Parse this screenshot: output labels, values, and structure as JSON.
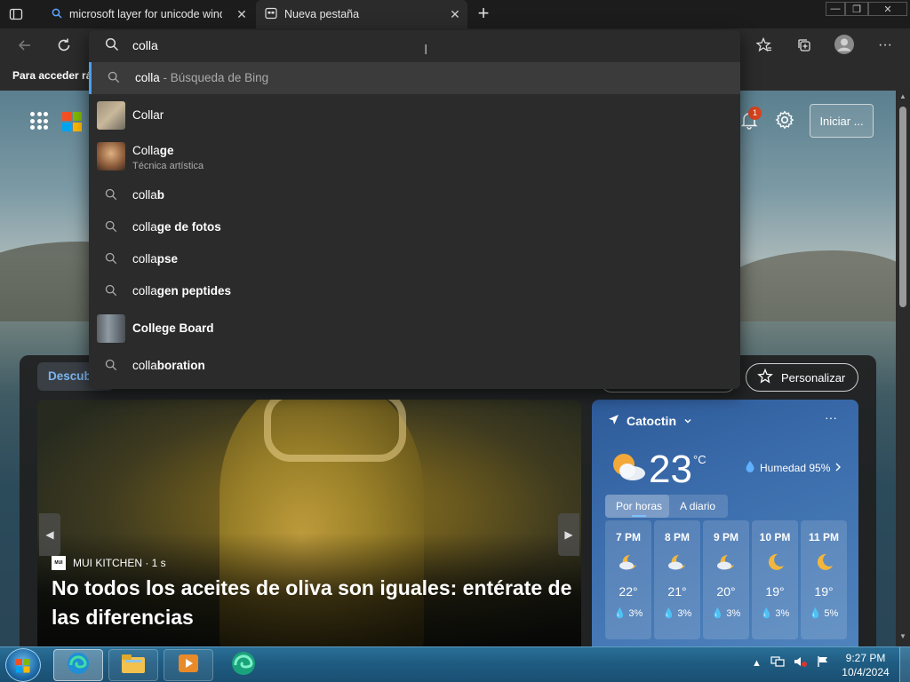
{
  "tabs": [
    {
      "title": "microsoft layer for unicode windows",
      "close": "✕"
    },
    {
      "title": "Nueva pestaña",
      "close": "✕"
    }
  ],
  "new_tab_label": "+",
  "window_controls": {
    "minimize": "—",
    "maximize": "❐",
    "close": "✕"
  },
  "favorites_bar_hint": "Para acceder rápidamente",
  "address_bar": {
    "value": "colla"
  },
  "suggestions": [
    {
      "typed": "colla",
      "completion": "",
      "suffix": " - Búsqueda de Bing",
      "subtitle": ""
    },
    {
      "typed": "Collar",
      "completion": "",
      "suffix": "",
      "subtitle": ""
    },
    {
      "typed": "Colla",
      "completion": "ge",
      "suffix": "",
      "subtitle": "Técnica artística"
    },
    {
      "typed": "colla",
      "completion": "b",
      "suffix": "",
      "subtitle": ""
    },
    {
      "typed": "colla",
      "completion": "ge de fotos",
      "suffix": "",
      "subtitle": ""
    },
    {
      "typed": "colla",
      "completion": "pse",
      "suffix": "",
      "subtitle": ""
    },
    {
      "typed": "colla",
      "completion": "gen peptides",
      "suffix": "",
      "subtitle": ""
    },
    {
      "typed": "",
      "completion": "College Board",
      "suffix": "",
      "subtitle": ""
    },
    {
      "typed": "colla",
      "completion": "boration",
      "suffix": "",
      "subtitle": ""
    }
  ],
  "header": {
    "notification_count": "1",
    "signin_label": "Iniciar ..."
  },
  "feed": {
    "discover_tab": "Descubrir",
    "personalize_label": "Personalizar",
    "hero": {
      "source": "MUI KITCHEN",
      "age": "· 1 s",
      "source_logo_text": "MUI",
      "headline": "No todos los aceites de oliva son iguales: entérate de las diferencias"
    }
  },
  "weather": {
    "location": "Catoctin",
    "more": "···",
    "temperature": "23",
    "unit": "°C",
    "humidity": "Humedad 95%",
    "tabs": [
      "Por horas",
      "A diario"
    ],
    "hourly": [
      {
        "time": "7 PM",
        "temp": "22°",
        "rain": "3%",
        "icon": "partly-cloudy-night-icon"
      },
      {
        "time": "8 PM",
        "temp": "21°",
        "rain": "3%",
        "icon": "partly-cloudy-night-icon"
      },
      {
        "time": "9 PM",
        "temp": "20°",
        "rain": "3%",
        "icon": "partly-cloudy-night-icon"
      },
      {
        "time": "10 PM",
        "temp": "19°",
        "rain": "3%",
        "icon": "moon-icon"
      },
      {
        "time": "11 PM",
        "temp": "19°",
        "rain": "5%",
        "icon": "moon-icon"
      }
    ]
  },
  "taskbar": {
    "clock_time": "9:27 PM",
    "clock_date": "10/4/2024"
  },
  "colors": {
    "accent": "#4c9eea",
    "badge": "#d8431f",
    "weather_bg": "#3d6fae"
  }
}
